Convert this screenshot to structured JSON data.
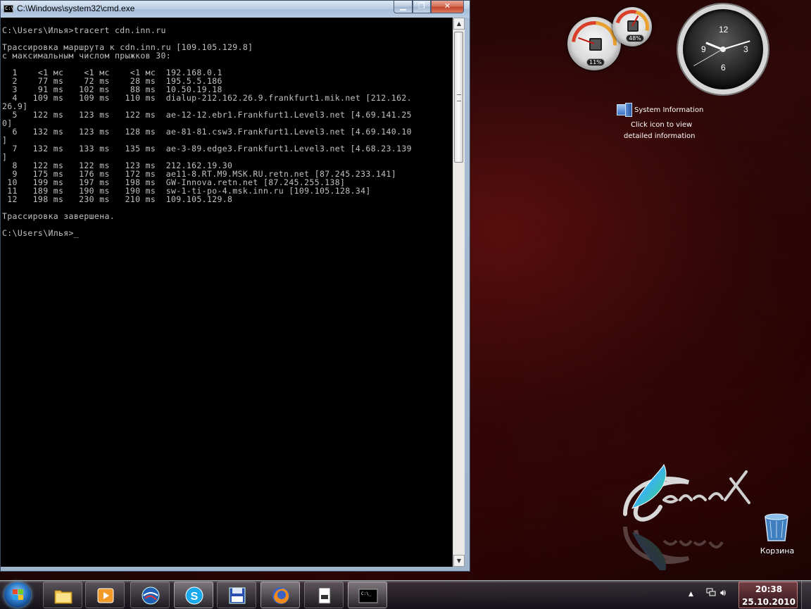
{
  "window": {
    "title": "C:\\Windows\\system32\\cmd.exe",
    "icon_text": "C:\\",
    "min_glyph": "▁",
    "max_glyph": "❐",
    "close_glyph": "✕"
  },
  "console": {
    "lines": [
      "",
      "C:\\Users\\Илья>tracert cdn.inn.ru",
      "",
      "Трассировка маршрута к cdn.inn.ru [109.105.129.8]",
      "с максимальным числом прыжков 30:",
      "",
      "  1    <1 мс    <1 мс    <1 мс  192.168.0.1",
      "  2    77 ms    72 ms    28 ms  195.5.5.186",
      "  3    91 ms   102 ms    88 ms  10.50.19.18",
      "  4   109 ms   109 ms   110 ms  dialup-212.162.26.9.frankfurt1.mik.net [212.162.",
      "26.9]",
      "  5   122 ms   123 ms   122 ms  ae-12-12.ebr1.Frankfurt1.Level3.net [4.69.141.25",
      "0]",
      "  6   132 ms   123 ms   128 ms  ae-81-81.csw3.Frankfurt1.Level3.net [4.69.140.10",
      "]",
      "  7   132 ms   133 ms   135 ms  ae-3-89.edge3.Frankfurt1.Level3.net [4.68.23.139",
      "]",
      "  8   122 ms   122 ms   123 ms  212.162.19.30",
      "  9   175 ms   176 ms   172 ms  ae11-8.RT.M9.MSK.RU.retn.net [87.245.233.141]",
      " 10   199 ms   197 ms   198 ms  GW-Innova.retn.net [87.245.255.138]",
      " 11   189 ms   190 ms   190 ms  sw-1-ti-po-4.msk.inn.ru [109.105.128.34]",
      " 12   198 ms   230 ms   210 ms  109.105.129.8",
      "",
      "Трассировка завершена.",
      "",
      "C:\\Users\\Илья>"
    ],
    "cursor": "_"
  },
  "gadgets": {
    "cpu_meter": {
      "value_label": "11%",
      "value": 11
    },
    "memory_meter": {
      "value_label": "48%",
      "value": 48
    },
    "clock": {
      "n12": "12",
      "n3": "3",
      "n6": "6",
      "n9": "9"
    },
    "system_information": {
      "title": "System Information",
      "desc_line1": "Click icon to view",
      "desc_line2": "detailed information"
    }
  },
  "desktop": {
    "recycle_bin_label": "Корзина"
  },
  "taskbar": {
    "items": [
      "windows-explorer",
      "media-player",
      "google-earth",
      "skype",
      "save-utility",
      "firefox",
      "notepad",
      "cmd"
    ],
    "time": "20:38",
    "date": "25.10.2010"
  },
  "colors": {
    "console_bg": "#000000",
    "console_fg": "#c0c0c0",
    "desktop_accent": "#2b0808"
  }
}
